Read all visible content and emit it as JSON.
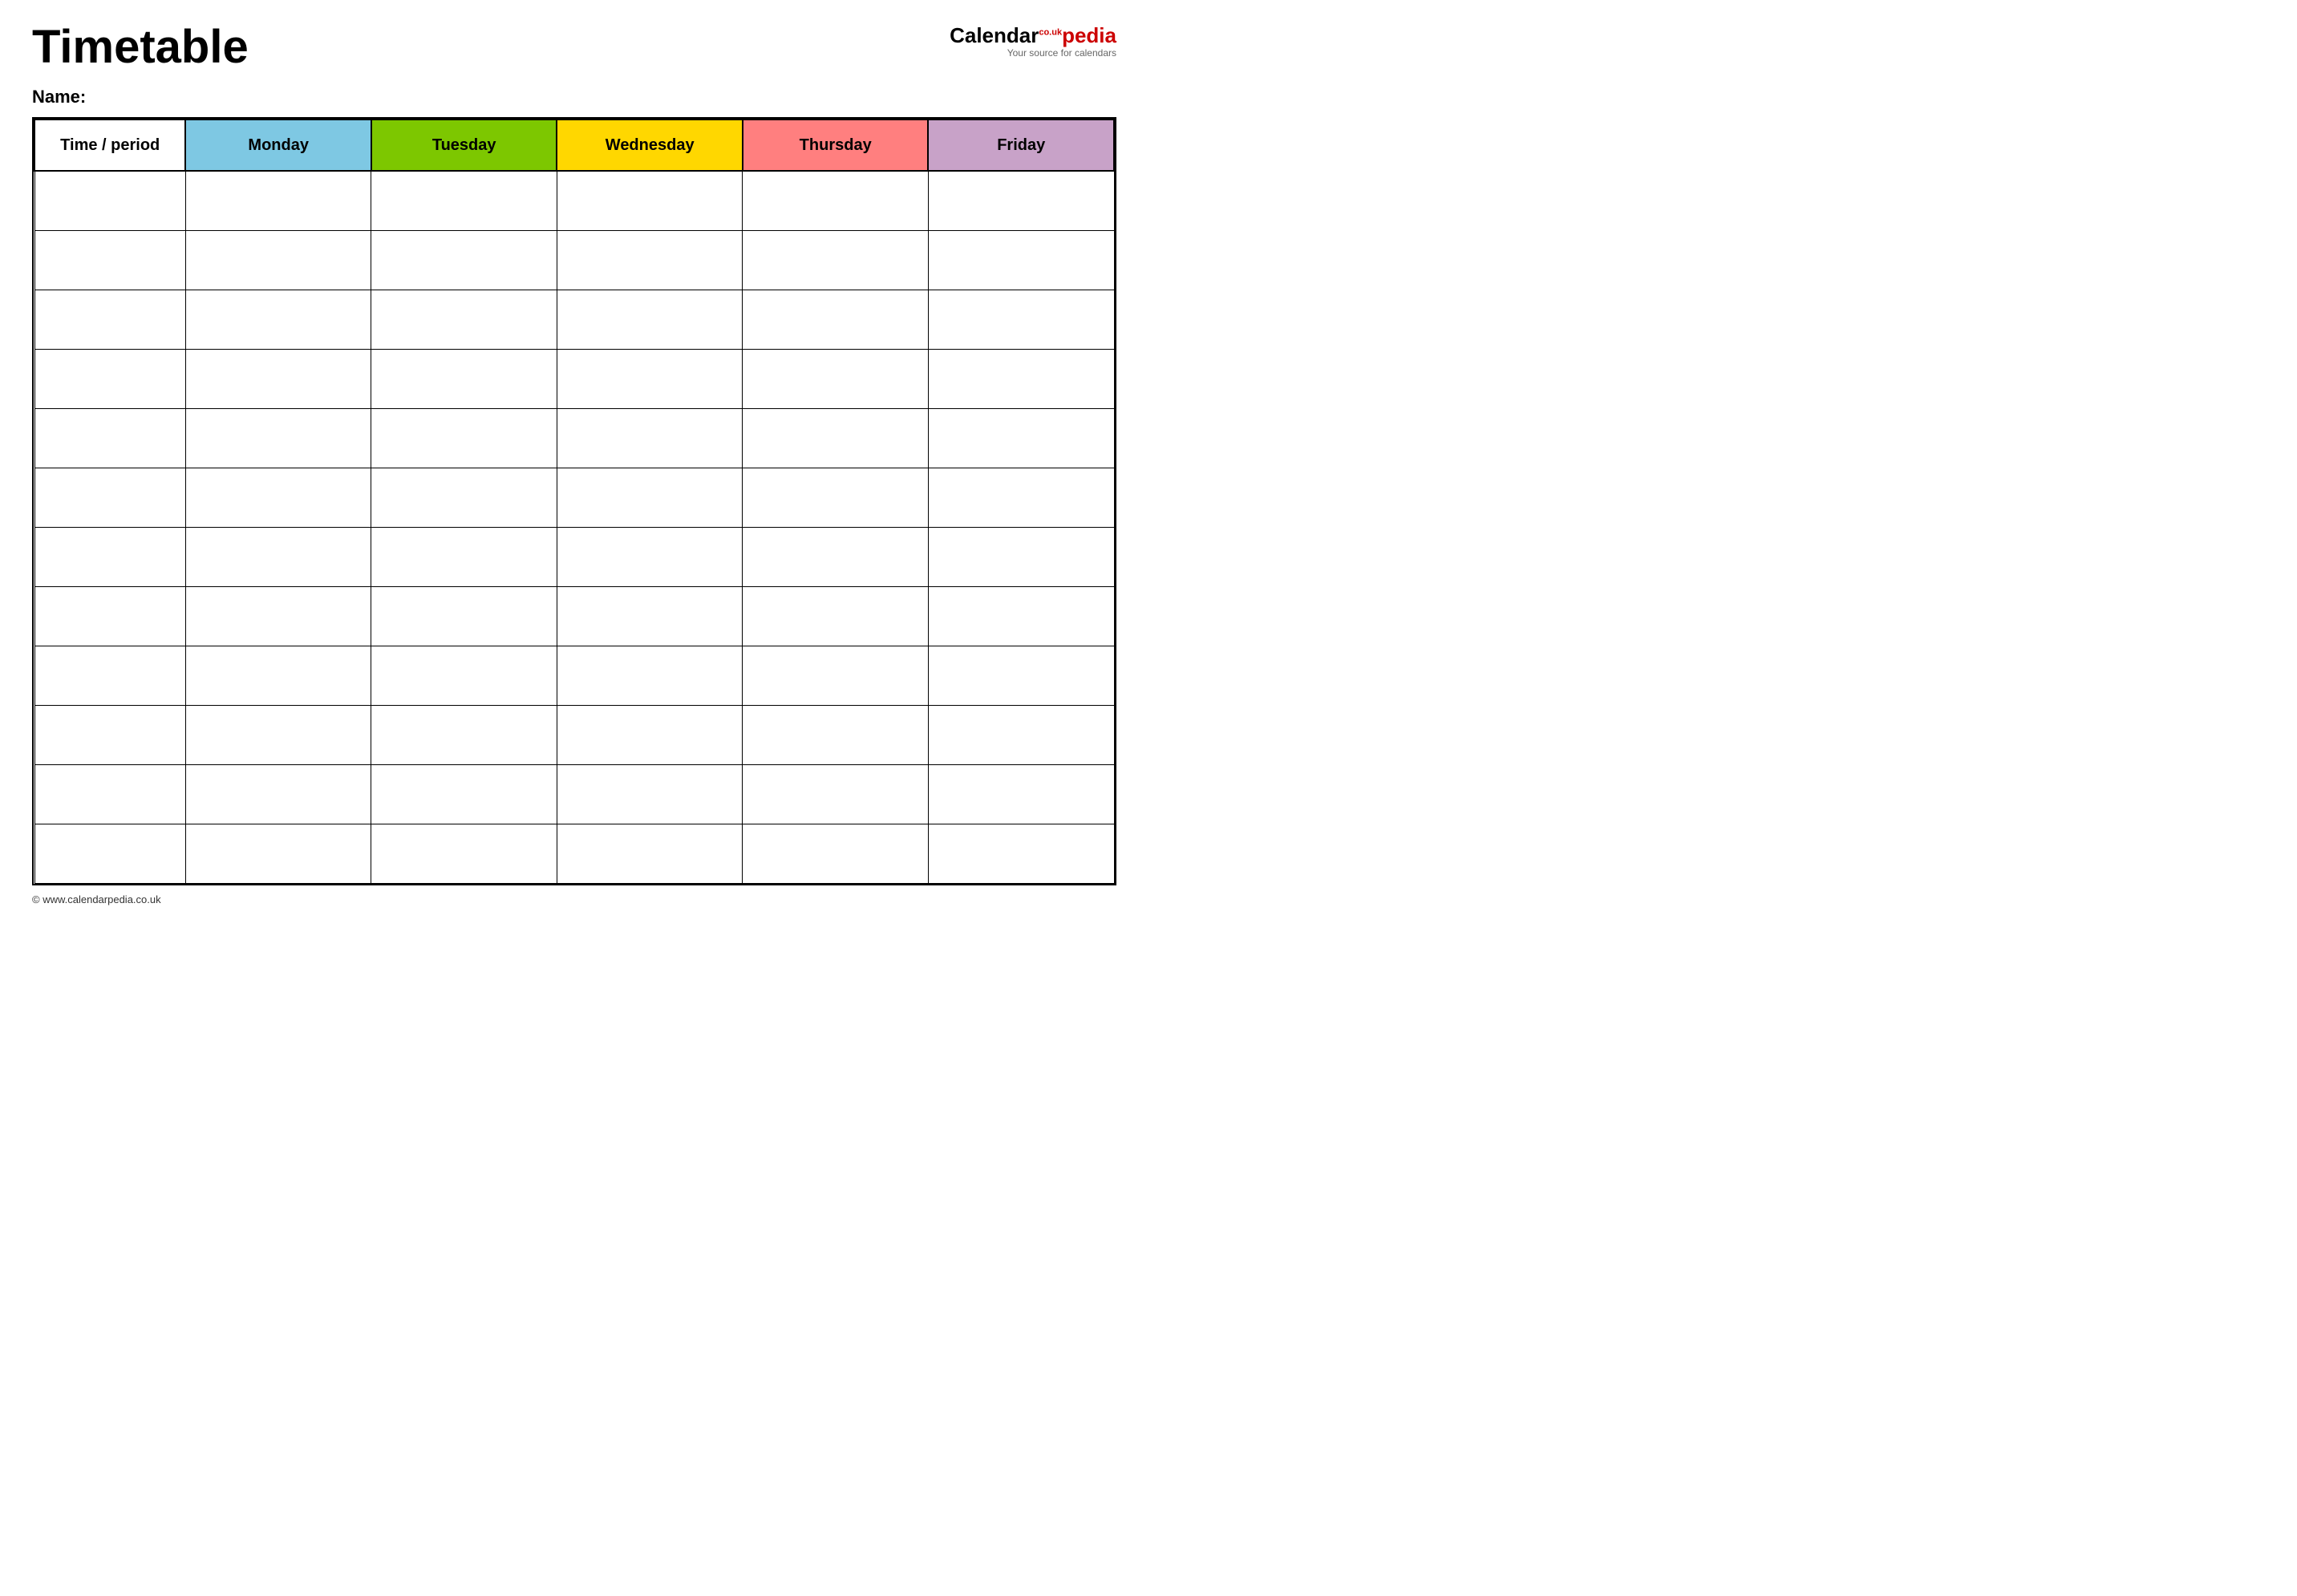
{
  "header": {
    "title": "Timetable",
    "logo": {
      "calendar_text": "Calendar",
      "pedia_text": "pedia",
      "couk_text": "co.uk",
      "subtitle": "Your source for calendars"
    }
  },
  "name_section": {
    "label": "Name:"
  },
  "table": {
    "columns": [
      {
        "id": "time",
        "label": "Time / period",
        "class": "col-time"
      },
      {
        "id": "monday",
        "label": "Monday",
        "class": "col-monday"
      },
      {
        "id": "tuesday",
        "label": "Tuesday",
        "class": "col-tuesday"
      },
      {
        "id": "wednesday",
        "label": "Wednesday",
        "class": "col-wednesday"
      },
      {
        "id": "thursday",
        "label": "Thursday",
        "class": "col-thursday"
      },
      {
        "id": "friday",
        "label": "Friday",
        "class": "col-friday"
      }
    ],
    "row_count": 12
  },
  "footer": {
    "url": "www.calendarpedia.co.uk",
    "text": "© www.calendarpedia.co.uk"
  }
}
